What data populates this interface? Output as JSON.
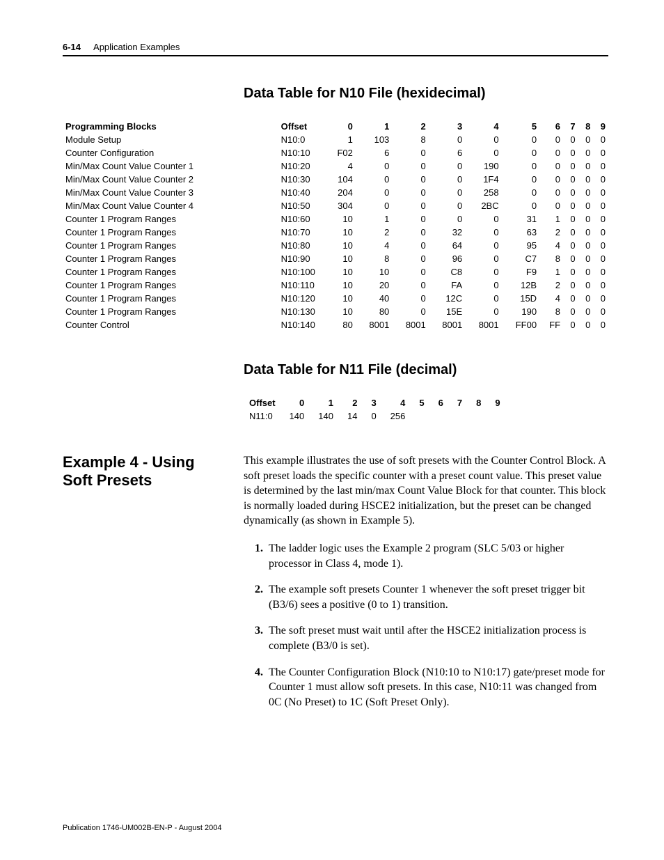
{
  "header": {
    "page_number": "6-14",
    "chapter_title": "Application Examples"
  },
  "table_n10": {
    "title": "Data Table for N10 File (hexidecimal)",
    "col_label_block": "Programming Blocks",
    "col_label_offset": "Offset",
    "col_headers": [
      "0",
      "1",
      "2",
      "3",
      "4",
      "5",
      "6",
      "7",
      "8",
      "9"
    ],
    "rows": [
      {
        "block": "Module Setup",
        "offset": "N10:0",
        "v": [
          "1",
          "103",
          "8",
          "0",
          "0",
          "0",
          "0",
          "0",
          "0",
          "0"
        ]
      },
      {
        "block": "Counter Configuration",
        "offset": "N10:10",
        "v": [
          "F02",
          "6",
          "0",
          "6",
          "0",
          "0",
          "0",
          "0",
          "0",
          "0"
        ]
      },
      {
        "block": "Min/Max Count Value Counter 1",
        "offset": "N10:20",
        "v": [
          "4",
          "0",
          "0",
          "0",
          "190",
          "0",
          "0",
          "0",
          "0",
          "0"
        ]
      },
      {
        "block": "Min/Max Count Value Counter 2",
        "offset": "N10:30",
        "v": [
          "104",
          "0",
          "0",
          "0",
          "1F4",
          "0",
          "0",
          "0",
          "0",
          "0"
        ]
      },
      {
        "block": "Min/Max Count Value Counter 3",
        "offset": "N10:40",
        "v": [
          "204",
          "0",
          "0",
          "0",
          "258",
          "0",
          "0",
          "0",
          "0",
          "0"
        ]
      },
      {
        "block": "Min/Max Count Value Counter 4",
        "offset": "N10:50",
        "v": [
          "304",
          "0",
          "0",
          "0",
          "2BC",
          "0",
          "0",
          "0",
          "0",
          "0"
        ]
      },
      {
        "block": "Counter 1 Program Ranges",
        "offset": "N10:60",
        "v": [
          "10",
          "1",
          "0",
          "0",
          "0",
          "31",
          "1",
          "0",
          "0",
          "0"
        ]
      },
      {
        "block": "Counter 1 Program Ranges",
        "offset": "N10:70",
        "v": [
          "10",
          "2",
          "0",
          "32",
          "0",
          "63",
          "2",
          "0",
          "0",
          "0"
        ]
      },
      {
        "block": "Counter 1 Program Ranges",
        "offset": "N10:80",
        "v": [
          "10",
          "4",
          "0",
          "64",
          "0",
          "95",
          "4",
          "0",
          "0",
          "0"
        ]
      },
      {
        "block": "Counter 1 Program Ranges",
        "offset": "N10:90",
        "v": [
          "10",
          "8",
          "0",
          "96",
          "0",
          "C7",
          "8",
          "0",
          "0",
          "0"
        ]
      },
      {
        "block": "Counter 1 Program Ranges",
        "offset": "N10:100",
        "v": [
          "10",
          "10",
          "0",
          "C8",
          "0",
          "F9",
          "1",
          "0",
          "0",
          "0"
        ]
      },
      {
        "block": "Counter 1 Program Ranges",
        "offset": "N10:110",
        "v": [
          "10",
          "20",
          "0",
          "FA",
          "0",
          "12B",
          "2",
          "0",
          "0",
          "0"
        ]
      },
      {
        "block": "Counter 1 Program Ranges",
        "offset": "N10:120",
        "v": [
          "10",
          "40",
          "0",
          "12C",
          "0",
          "15D",
          "4",
          "0",
          "0",
          "0"
        ]
      },
      {
        "block": "Counter 1 Program Ranges",
        "offset": "N10:130",
        "v": [
          "10",
          "80",
          "0",
          "15E",
          "0",
          "190",
          "8",
          "0",
          "0",
          "0"
        ]
      },
      {
        "block": "Counter Control",
        "offset": "N10:140",
        "v": [
          "80",
          "8001",
          "8001",
          "8001",
          "8001",
          "FF00",
          "FF",
          "0",
          "0",
          "0"
        ]
      }
    ]
  },
  "table_n11": {
    "title": "Data Table for N11 File (decimal)",
    "col_label_offset": "Offset",
    "col_headers": [
      "0",
      "1",
      "2",
      "3",
      "4",
      "5",
      "6",
      "7",
      "8",
      "9"
    ],
    "rows": [
      {
        "offset": "N11:0",
        "v": [
          "140",
          "140",
          "14",
          "0",
          "256",
          "",
          "",
          "",
          "",
          ""
        ]
      }
    ]
  },
  "example4": {
    "heading": "Example 4 - Using Soft Presets",
    "intro": "This example illustrates the use of soft presets with the Counter Control Block. A soft preset loads the specific counter with a preset count value. This preset value is determined by the last min/max Count Value Block for that counter. This block is normally loaded during HSCE2 initialization, but the preset can be changed dynamically (as shown in Example 5).",
    "steps": [
      "The ladder logic uses the Example 2 program (SLC 5/03 or higher processor in Class 4, mode 1).",
      "The example soft presets Counter 1 whenever the soft preset trigger bit (B3/6) sees a positive (0 to 1) transition.",
      "The soft preset must wait until after the HSCE2 initialization process is complete (B3/0 is set).",
      "The Counter Configuration Block (N10:10 to N10:17) gate/preset mode for Counter 1 must allow soft presets. In this case, N10:11 was changed from 0C (No Preset) to 1C (Soft Preset Only)."
    ]
  },
  "footer": {
    "publication": "Publication 1746-UM002B-EN-P - August 2004"
  }
}
